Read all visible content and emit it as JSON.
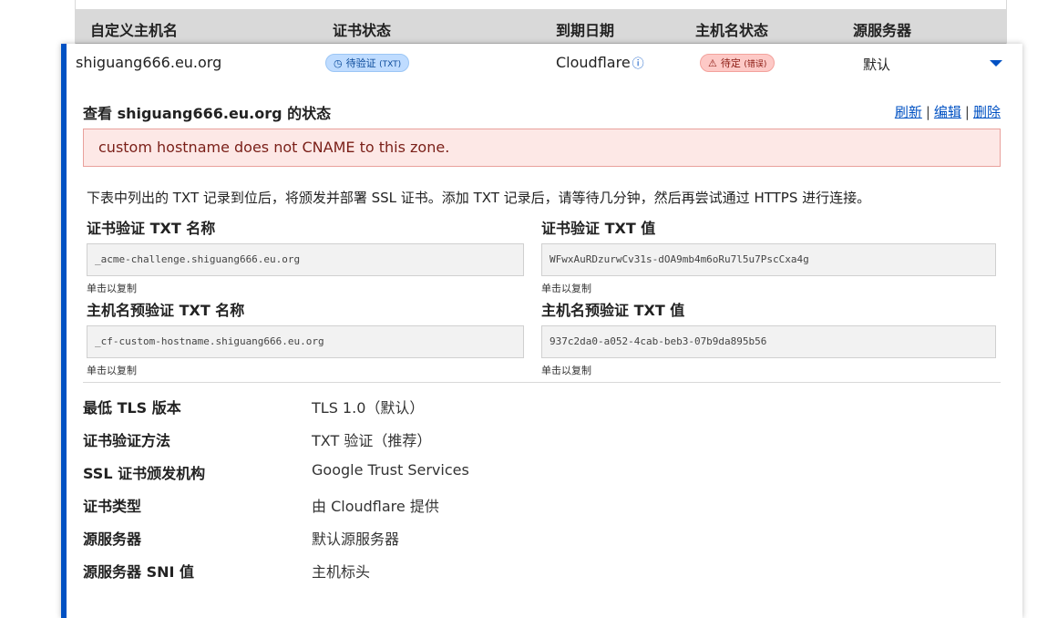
{
  "table": {
    "headers": [
      "自定义主机名",
      "证书状态",
      "到期日期",
      "主机名状态",
      "源服务器"
    ]
  },
  "row": {
    "hostname": "shiguang666.eu.org",
    "cert_status": {
      "label": "待验证",
      "suffix": "(TXT)",
      "icon": "clock-icon"
    },
    "expiry": "Cloudflare",
    "host_status": {
      "label": "待定",
      "suffix": "(错误)",
      "icon": "warning-icon"
    },
    "origin": "默认"
  },
  "detail": {
    "title_prefix": "查看 ",
    "title_host": "shiguang666.eu.org",
    "title_suffix": " 的状态",
    "actions": {
      "refresh": "刷新",
      "edit": "编辑",
      "delete": "删除",
      "separator": "|"
    },
    "error": "custom hostname does not CNAME to this zone.",
    "description": "下表中列出的 TXT 记录到位后，将颁发并部署 SSL 证书。添加 TXT 记录后，请等待几分钟，然后再尝试通过 HTTPS 进行连接。",
    "fields": [
      {
        "label": "证书验证 TXT 名称",
        "value": "_acme-challenge.shiguang666.eu.org",
        "hint": "单击以复制"
      },
      {
        "label": "证书验证 TXT 值",
        "value": "WFwxAuRDzurwCv31s-dOA9mb4m6oRu7l5u7PscCxa4g",
        "hint": "单击以复制"
      },
      {
        "label": "主机名预验证 TXT 名称",
        "value": "_cf-custom-hostname.shiguang666.eu.org",
        "hint": "单击以复制"
      },
      {
        "label": "主机名预验证 TXT 值",
        "value": "937c2da0-a052-4cab-beb3-07b9da895b56",
        "hint": "单击以复制"
      }
    ],
    "properties": [
      {
        "label": "最低 TLS 版本",
        "value": "TLS 1.0（默认）"
      },
      {
        "label": "证书验证方法",
        "value": "TXT 验证（推荐）"
      },
      {
        "label": "SSL 证书颁发机构",
        "value": "Google Trust Services"
      },
      {
        "label": "证书类型",
        "value": "由 Cloudflare 提供"
      },
      {
        "label": "源服务器",
        "value": "默认源服务器"
      },
      {
        "label": "源服务器 SNI 值",
        "value": "主机标头"
      }
    ]
  },
  "colors": {
    "accent": "#0051c3",
    "error_bg": "#fde8e6",
    "badge_blue": "#bfdcff",
    "badge_red": "#fdc9c6"
  }
}
